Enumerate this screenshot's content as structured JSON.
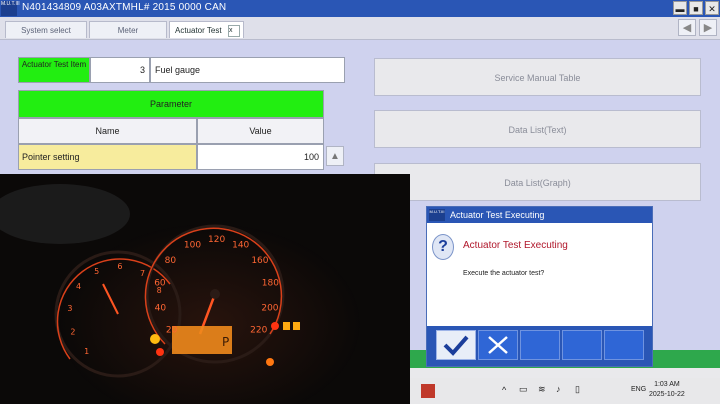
{
  "window": {
    "title": "N401434809   A03AXTMHL# 2015    0000 CAN",
    "logo_text": "M.U.T.III"
  },
  "tabs": [
    {
      "label": "System select"
    },
    {
      "label": "Meter"
    },
    {
      "label": "Actuator Test",
      "close": "x"
    }
  ],
  "actuator": {
    "label": "Actuator Test Item",
    "number": "3",
    "name": "Fuel gauge"
  },
  "parameter_table": {
    "header": "Parameter",
    "columns": [
      "Name",
      "Value"
    ],
    "rows": [
      {
        "name": "Pointer setting",
        "value": "100"
      }
    ]
  },
  "buttons": {
    "service_manual": "Service Manual Table",
    "data_list_text": "Data List(Text)",
    "data_list_graph": "Data List(Graph)"
  },
  "dialog": {
    "title": "Actuator Test Executing",
    "heading": "Actuator Test Executing",
    "message": "Execute the actuator test?",
    "logo_text": "M.U.T.III"
  },
  "gauge": {
    "speed_ticks": [
      "20",
      "40",
      "60",
      "80",
      "100",
      "120",
      "140",
      "160",
      "180",
      "200",
      "220"
    ],
    "rpm_ticks": [
      "1",
      "2",
      "3",
      "4",
      "5",
      "6",
      "7",
      "8"
    ],
    "odo_label": "P"
  },
  "taskbar": {
    "language": "ENG",
    "time": "1:03 AM",
    "date": "2025-10-22"
  },
  "colors": {
    "accent": "#2a56b5",
    "green": "#22ee11",
    "highlight": "#f7ec9d"
  }
}
